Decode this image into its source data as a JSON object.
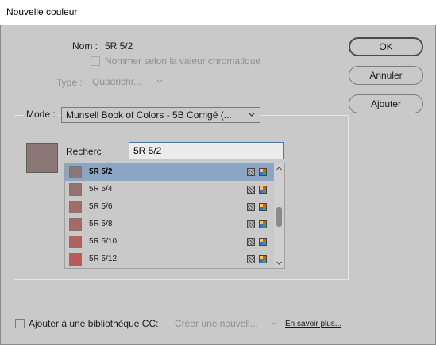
{
  "window": {
    "title": "Nouvelle couleur"
  },
  "name": {
    "label": "Nom :",
    "value": "5R 5/2"
  },
  "chroma_option": {
    "label": "Nommer selon la valeur chromatique",
    "checked": false,
    "enabled": false
  },
  "type": {
    "label": "Type :",
    "value": "Quadrichr...",
    "enabled": false
  },
  "mode": {
    "label": "Mode :",
    "value": "Munsell Book of Colors - 5B Corrigé (..."
  },
  "preview": {
    "color": "#8a7776"
  },
  "search": {
    "label": "Recherc",
    "value": "5R 5/2"
  },
  "swatches": [
    {
      "name": "5R 5/2",
      "color": "#8b7675",
      "selected": true,
      "gamut_icon": "out-of-gamut-icon",
      "cmyk_icon": "cmyk-mode-icon"
    },
    {
      "name": "5R 5/4",
      "color": "#957270",
      "selected": false,
      "gamut_icon": "out-of-gamut-icon",
      "cmyk_icon": "cmyk-mode-icon"
    },
    {
      "name": "5R 5/6",
      "color": "#9f6d6a",
      "selected": false,
      "gamut_icon": "out-of-gamut-icon",
      "cmyk_icon": "cmyk-mode-icon"
    },
    {
      "name": "5R 5/8",
      "color": "#a86965",
      "selected": false,
      "gamut_icon": "out-of-gamut-icon",
      "cmyk_icon": "cmyk-mode-icon"
    },
    {
      "name": "5R 5/10",
      "color": "#b2625e",
      "selected": false,
      "gamut_icon": "out-of-gamut-icon",
      "cmyk_icon": "cmyk-mode-icon"
    },
    {
      "name": "5R 5/12",
      "color": "#bc5a57",
      "selected": false,
      "gamut_icon": "out-of-gamut-icon",
      "cmyk_icon": "cmyk-mode-icon"
    }
  ],
  "buttons": {
    "ok": "OK",
    "cancel": "Annuler",
    "add": "Ajouter"
  },
  "library": {
    "label": "Ajouter à une bibliothèque CC:",
    "checked": false,
    "dropdown": "Créer une nouvell...",
    "link": "En savoir plus..."
  }
}
